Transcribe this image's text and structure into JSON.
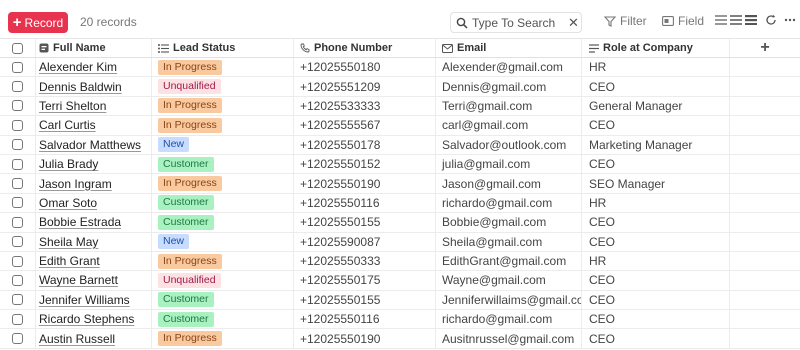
{
  "toolbar": {
    "record_label": "Record",
    "record_count": "20 records",
    "search_placeholder": "Type To Search",
    "filter_label": "Filter",
    "field_label": "Field"
  },
  "columns": {
    "name": "Full Name",
    "status": "Lead Status",
    "phone": "Phone Number",
    "email": "Email",
    "role": "Role at Company",
    "add": "+"
  },
  "status_colors": {
    "In Progress": "#f9c9a0",
    "Unqualified": "#fde2e4",
    "New": "#c7dcff",
    "Customer": "#a9f1c1"
  },
  "rows": [
    {
      "name": "Alexender Kim",
      "status": "In Progress",
      "phone": "+12025550180",
      "email": "Alexender@gmail.com",
      "role": "HR"
    },
    {
      "name": "Dennis Baldwin",
      "status": "Unqualified",
      "phone": "+12025551209",
      "email": "Dennis@gmail.com",
      "role": "CEO"
    },
    {
      "name": "Terri Shelton",
      "status": "In Progress",
      "phone": "+12025533333",
      "email": "Terri@gmail.com",
      "role": "General Manager"
    },
    {
      "name": "Carl Curtis",
      "status": "In Progress",
      "phone": "+12025555567",
      "email": "carl@gmail.com",
      "role": "CEO"
    },
    {
      "name": "Salvador Matthews",
      "status": "New",
      "phone": "+12025550178",
      "email": "Salvador@outlook.com",
      "role": "Marketing Manager"
    },
    {
      "name": "Julia Brady",
      "status": "Customer",
      "phone": "+12025550152",
      "email": "julia@gmail.com",
      "role": "CEO"
    },
    {
      "name": "Jason Ingram",
      "status": "In Progress",
      "phone": "+12025550190",
      "email": "Jason@gmail.com",
      "role": "SEO Manager"
    },
    {
      "name": "Omar Soto",
      "status": "Customer",
      "phone": "+12025550116",
      "email": "richardo@gmail.com",
      "role": "HR"
    },
    {
      "name": "Bobbie Estrada",
      "status": "Customer",
      "phone": "+12025550155",
      "email": "Bobbie@gmail.com",
      "role": "CEO"
    },
    {
      "name": "Sheila May",
      "status": "New",
      "phone": "+12025590087",
      "email": "Sheila@gmail.com",
      "role": "CEO"
    },
    {
      "name": "Edith Grant",
      "status": "In Progress",
      "phone": "+12025550333",
      "email": "EdithGrant@gmail.com",
      "role": "HR"
    },
    {
      "name": "Wayne Barnett",
      "status": "Unqualified",
      "phone": "+12025550175",
      "email": "Wayne@gmail.com",
      "role": "CEO"
    },
    {
      "name": "Jennifer Williams",
      "status": "Customer",
      "phone": "+12025550155",
      "email": "Jenniferwillaims@gmail.com",
      "role": "CEO"
    },
    {
      "name": "Ricardo Stephens",
      "status": "Customer",
      "phone": "+12025550116",
      "email": "richardo@gmail.com",
      "role": "CEO"
    },
    {
      "name": "Austin Russell",
      "status": "In Progress",
      "phone": "+12025550190",
      "email": "Ausitnrussel@gmail.com",
      "role": "CEO"
    }
  ]
}
